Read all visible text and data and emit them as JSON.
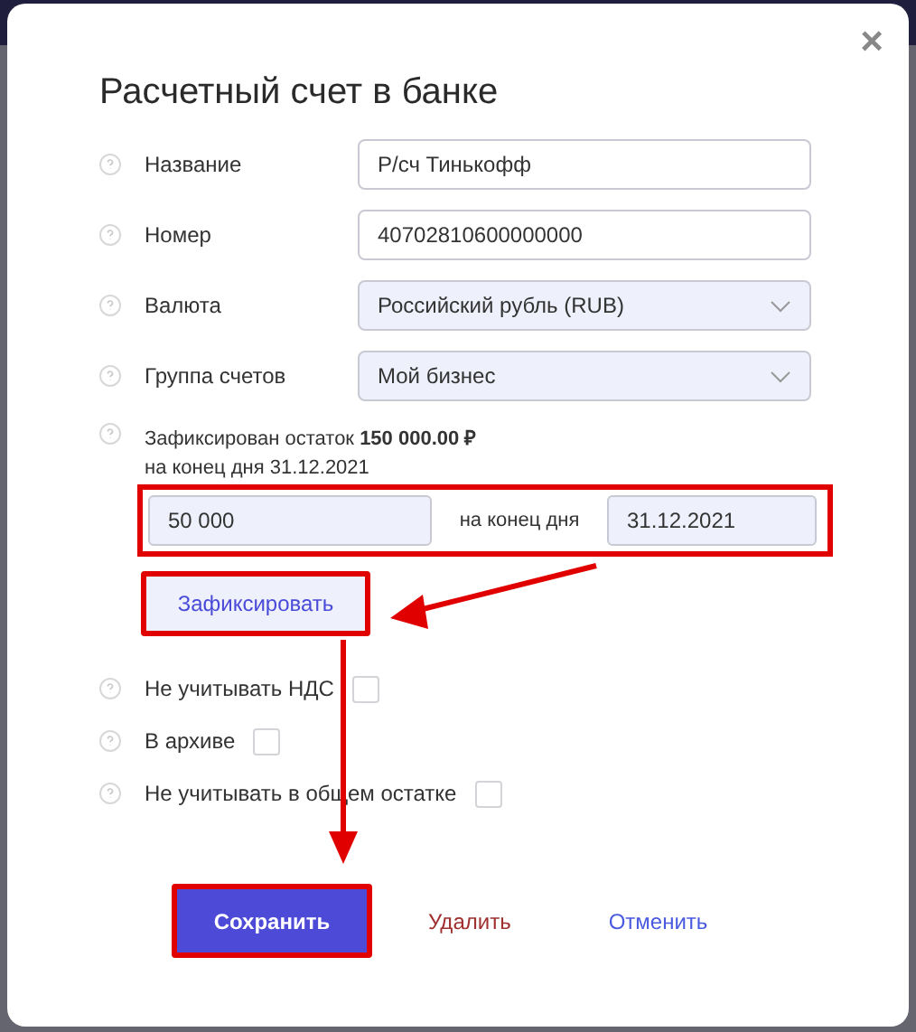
{
  "dialog": {
    "title": "Расчетный счет в банке",
    "close": "×"
  },
  "fields": [
    {
      "kind": "input",
      "label": "Название",
      "value": "Р/сч Тинькофф"
    },
    {
      "kind": "input",
      "label": "Номер",
      "value": "40702810600000000"
    },
    {
      "kind": "select",
      "label": "Валюта",
      "value": "Российский рубль (RUB)"
    },
    {
      "kind": "select",
      "label": "Группа счетов",
      "value": "Мой бизнес"
    }
  ],
  "fixed_balance": {
    "text": "Зафиксирован остаток **150 000.00 ₽**",
    "subtext": "на конец дня 31.12.2021",
    "amount": "50 000",
    "connector": "на конец дня",
    "date": "31.12.2021",
    "highlighted": true,
    "button": {
      "label": "Зафиксировать",
      "highlighted": true
    }
  },
  "checkboxes": [
    {
      "label": "Не учитывать НДС",
      "checked": false
    },
    {
      "label": "В архиве",
      "checked": false
    },
    {
      "label": "Не учитывать в общем остатке",
      "checked": false
    }
  ],
  "actions": [
    {
      "kind": "primary",
      "label": "Сохранить",
      "highlighted": true
    },
    {
      "kind": "danger",
      "label": "Удалить",
      "highlighted": false
    },
    {
      "kind": "link",
      "label": "Отменить",
      "highlighted": false
    }
  ]
}
